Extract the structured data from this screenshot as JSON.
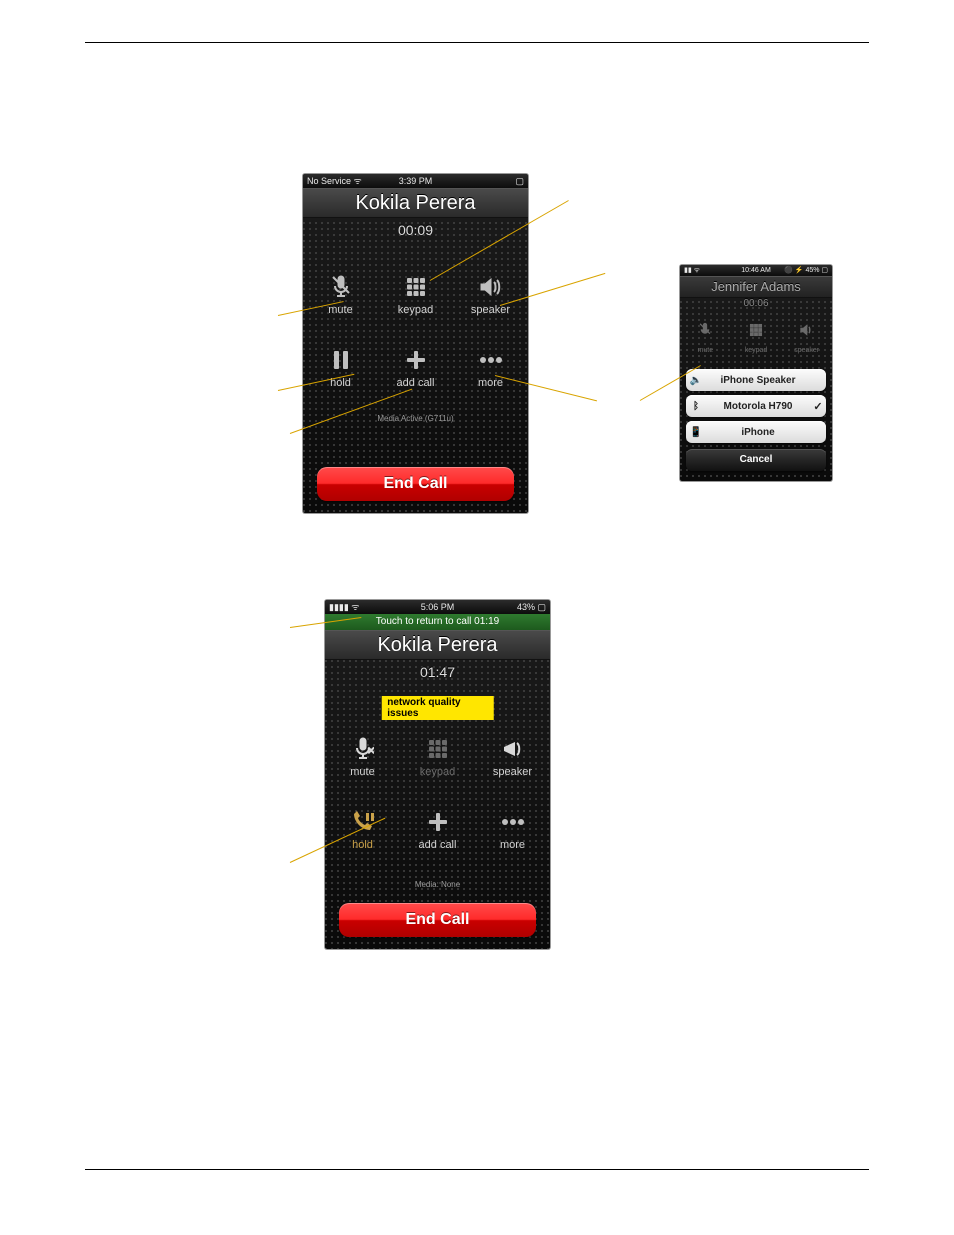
{
  "phone1": {
    "status_left": "No Service  ᯤ",
    "status_time": "3:39 PM",
    "status_right": "▢",
    "caller_name": "Kokila Perera",
    "timer": "00:09",
    "buttons": {
      "mute": "mute",
      "keypad": "keypad",
      "speaker": "speaker",
      "hold": "hold",
      "addcall": "add call",
      "more": "more"
    },
    "media_line": "Media Active (G711u)",
    "page_dots": "•  ⋯",
    "end_call": "End Call"
  },
  "phone2": {
    "status_left": "▮▮▮▮   ᯤ",
    "status_time": "5:06 PM",
    "status_right": "43% ▢",
    "return_banner": "Touch to return to call  01:19",
    "caller_name": "Kokila Perera",
    "timer": "01:47",
    "network_quality": "network quality issues",
    "buttons": {
      "mute": "mute",
      "keypad": "keypad",
      "speaker": "speaker",
      "hold": "hold",
      "addcall": "add call",
      "more": "more"
    },
    "media_line": "Media: None",
    "end_call": "End Call"
  },
  "sheet": {
    "status_time": "10:46 AM",
    "status_right": "⚫ ⚡ 45% ▢",
    "caller_name": "Jennifer Adams",
    "timer": "00:06",
    "grid": {
      "mute": "mute",
      "keypad": "keypad",
      "speaker": "speaker"
    },
    "opt1": "iPhone Speaker",
    "opt2": "Motorola H790",
    "opt2_checked": "✓",
    "opt3": "iPhone",
    "cancel": "Cancel"
  }
}
